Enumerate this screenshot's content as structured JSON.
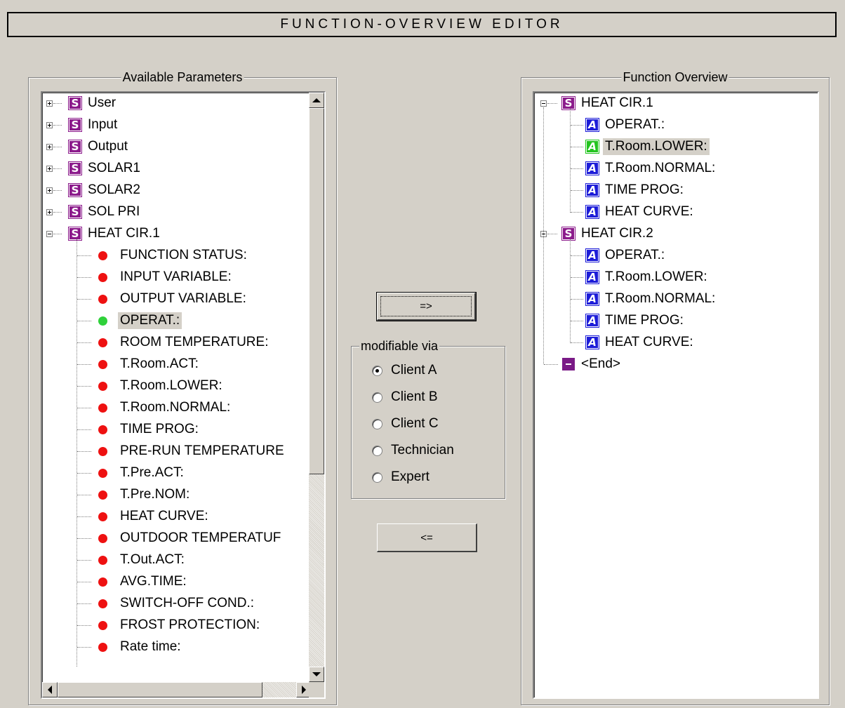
{
  "title": "FUNCTION-OVERVIEW EDITOR",
  "available": {
    "legend": "Available Parameters",
    "groups": [
      {
        "label": "User",
        "expanded": false,
        "icon": "S"
      },
      {
        "label": "Input",
        "expanded": false,
        "icon": "S"
      },
      {
        "label": "Output",
        "expanded": false,
        "icon": "S"
      },
      {
        "label": "SOLAR1",
        "expanded": false,
        "icon": "S"
      },
      {
        "label": "SOLAR2",
        "expanded": false,
        "icon": "S"
      },
      {
        "label": "SOL PRI",
        "expanded": false,
        "icon": "S"
      },
      {
        "label": "HEAT CIR.1",
        "expanded": true,
        "icon": "S"
      }
    ],
    "items": [
      {
        "label": "FUNCTION STATUS:",
        "status": "red"
      },
      {
        "label": "INPUT VARIABLE:",
        "status": "red"
      },
      {
        "label": "OUTPUT VARIABLE:",
        "status": "red"
      },
      {
        "label": "OPERAT.:",
        "status": "green",
        "selected": true
      },
      {
        "label": "ROOM TEMPERATURE:",
        "status": "red"
      },
      {
        "label": "T.Room.ACT:",
        "status": "red"
      },
      {
        "label": "T.Room.LOWER:",
        "status": "red"
      },
      {
        "label": "T.Room.NORMAL:",
        "status": "red"
      },
      {
        "label": "TIME PROG:",
        "status": "red"
      },
      {
        "label": "PRE-RUN TEMPERATURE",
        "status": "red"
      },
      {
        "label": "T.Pre.ACT:",
        "status": "red"
      },
      {
        "label": "T.Pre.NOM:",
        "status": "red"
      },
      {
        "label": "HEAT CURVE:",
        "status": "red"
      },
      {
        "label": "OUTDOOR TEMPERATUF",
        "status": "red"
      },
      {
        "label": "T.Out.ACT:",
        "status": "red"
      },
      {
        "label": "AVG.TIME:",
        "status": "red"
      },
      {
        "label": "SWITCH-OFF COND.:",
        "status": "red"
      },
      {
        "label": "FROST PROTECTION:",
        "status": "red"
      },
      {
        "label": "Rate time:",
        "status": "red"
      }
    ]
  },
  "buttons": {
    "add": "=>",
    "remove": "<="
  },
  "modifiable": {
    "legend": "modifiable via",
    "options": [
      "Client A",
      "Client B",
      "Client C",
      "Technician",
      "Expert"
    ],
    "selected": "Client A"
  },
  "overview": {
    "legend": "Function Overview",
    "groups": [
      {
        "label": "HEAT CIR.1",
        "icon": "S",
        "items": [
          {
            "label": "OPERAT.:",
            "icon": "A"
          },
          {
            "label": "T.Room.LOWER:",
            "icon": "A",
            "selected": true
          },
          {
            "label": "T.Room.NORMAL:",
            "icon": "A"
          },
          {
            "label": "TIME PROG:",
            "icon": "A"
          },
          {
            "label": "HEAT CURVE:",
            "icon": "A"
          }
        ]
      },
      {
        "label": "HEAT CIR.2",
        "icon": "S",
        "items": [
          {
            "label": "OPERAT.:",
            "icon": "A"
          },
          {
            "label": "T.Room.LOWER:",
            "icon": "A"
          },
          {
            "label": "T.Room.NORMAL:",
            "icon": "A"
          },
          {
            "label": "TIME PROG:",
            "icon": "A"
          },
          {
            "label": "HEAT CURVE:",
            "icon": "A"
          }
        ]
      }
    ],
    "end_label": "<End>"
  },
  "colors": {
    "background": "#d4d0c8",
    "s_icon": "#8b1a8b",
    "a_icon": "#1c1cd8",
    "a_icon_selected": "#22c41e",
    "dot_red": "#ee1111",
    "dot_green": "#2fd13a"
  }
}
